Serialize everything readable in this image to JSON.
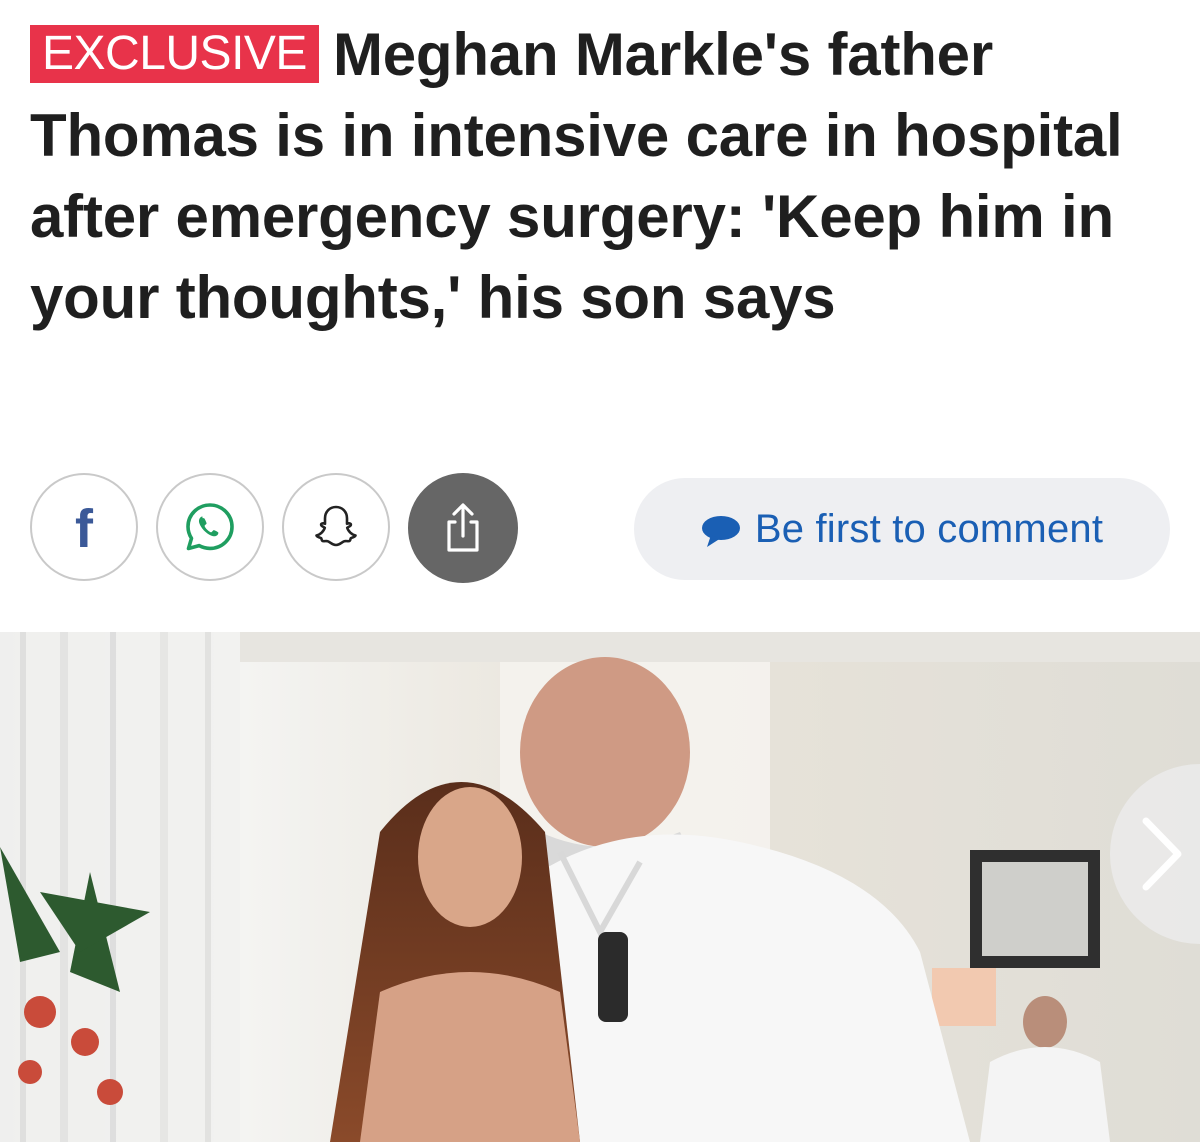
{
  "headline": {
    "tag": "EXCLUSIVE",
    "text": "Meghan Markle's father Thomas is in intensive care in hospital after emergency surgery: 'Keep him in your thoughts,' his son says"
  },
  "share": {
    "buttons": [
      {
        "icon": "facebook-icon"
      },
      {
        "icon": "whatsapp-icon"
      },
      {
        "icon": "snapchat-icon"
      },
      {
        "icon": "share-icon"
      }
    ],
    "comment_label": "Be first to comment"
  },
  "colors": {
    "tag_background": "#e8334a",
    "headline_text": "#1f1f1f",
    "comment_text": "#1a5fb4",
    "comment_pill_bg": "#eeeff2",
    "share_button_active": "#666666"
  },
  "gallery": {
    "next_icon": "chevron-right-icon"
  }
}
